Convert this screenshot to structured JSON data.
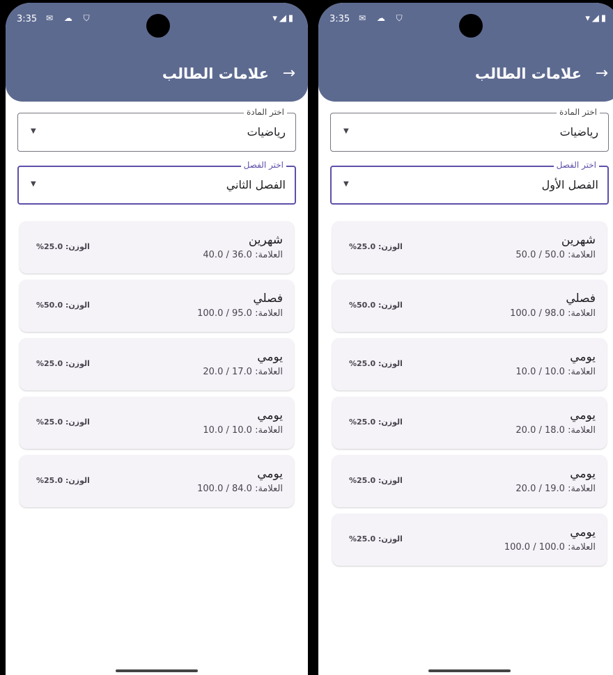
{
  "screens": [
    {
      "status": {
        "time": "3:35",
        "left_icons": "✉ ☁ ⛉",
        "right_icons": "▾◢▮"
      },
      "app_title": "علامات الطالب",
      "back_icon": "→",
      "subject_select": {
        "label": "اختر المادة",
        "value": "رياضيات"
      },
      "semester_select": {
        "label": "اختر الفصل",
        "value": "الفصل الثاني"
      },
      "grades": [
        {
          "name": "شهرين",
          "score": "العلامة: 36.0 / 40.0",
          "weight": "الوزن: 25.0%"
        },
        {
          "name": "فصلي",
          "score": "العلامة: 95.0 / 100.0",
          "weight": "الوزن: 50.0%"
        },
        {
          "name": "يومي",
          "score": "العلامة: 17.0 / 20.0",
          "weight": "الوزن: 25.0%"
        },
        {
          "name": "يومي",
          "score": "العلامة: 10.0 / 10.0",
          "weight": "الوزن: 25.0%"
        },
        {
          "name": "يومي",
          "score": "العلامة: 84.0 / 100.0",
          "weight": "الوزن: 25.0%"
        }
      ]
    },
    {
      "status": {
        "time": "3:35",
        "left_icons": "✉ ☁ ⛉",
        "right_icons": "▾◢▮"
      },
      "app_title": "علامات الطالب",
      "back_icon": "→",
      "subject_select": {
        "label": "اختر المادة",
        "value": "رياضيات"
      },
      "semester_select": {
        "label": "اختر الفصل",
        "value": "الفصل الأول"
      },
      "grades": [
        {
          "name": "شهرين",
          "score": "العلامة: 50.0 / 50.0",
          "weight": "الوزن: 25.0%"
        },
        {
          "name": "فصلي",
          "score": "العلامة: 98.0 / 100.0",
          "weight": "الوزن: 50.0%"
        },
        {
          "name": "يومي",
          "score": "العلامة: 10.0 / 10.0",
          "weight": "الوزن: 25.0%"
        },
        {
          "name": "يومي",
          "score": "العلامة: 18.0 / 20.0",
          "weight": "الوزن: 25.0%"
        },
        {
          "name": "يومي",
          "score": "العلامة: 19.0 / 20.0",
          "weight": "الوزن: 25.0%"
        },
        {
          "name": "يومي",
          "score": "العلامة: 100.0 / 100.0",
          "weight": "الوزن: 25.0%"
        }
      ]
    }
  ],
  "colors": {
    "appbar": "#5d6a90",
    "card": "#f5f2f8",
    "focus": "#5d4fa8"
  },
  "icons": {
    "back": "arrow-forward-icon",
    "caret": "dropdown-caret-icon"
  }
}
